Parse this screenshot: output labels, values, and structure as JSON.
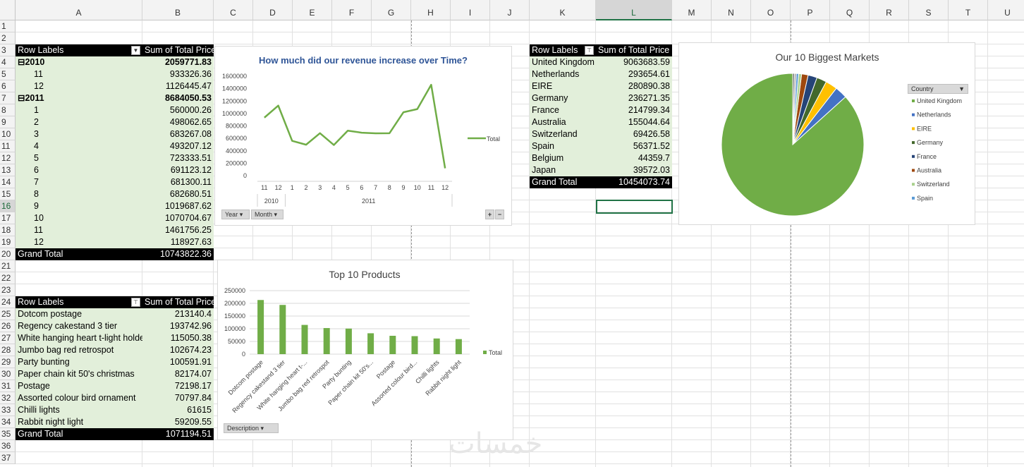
{
  "columns": [
    "A",
    "B",
    "C",
    "D",
    "E",
    "F",
    "G",
    "H",
    "I",
    "J",
    "K",
    "L",
    "M",
    "N",
    "O",
    "P",
    "Q",
    "R",
    "S",
    "T",
    "U"
  ],
  "rows": [
    "1",
    "2",
    "3",
    "4",
    "5",
    "6",
    "7",
    "8",
    "9",
    "10",
    "11",
    "12",
    "13",
    "14",
    "15",
    "16",
    "17",
    "18",
    "19",
    "20",
    "21",
    "22",
    "23",
    "24",
    "25",
    "26",
    "27",
    "28",
    "29",
    "30",
    "31",
    "32",
    "33",
    "34",
    "35",
    "36",
    "37"
  ],
  "pivot_revenue": {
    "header_labels": "Row Labels",
    "header_value": "Sum of Total Price",
    "rows": [
      {
        "label": "⊟2010",
        "value": "2059771.83",
        "bold": true
      },
      {
        "label": "11",
        "value": "933326.36"
      },
      {
        "label": "12",
        "value": "1126445.47"
      },
      {
        "label": "⊟2011",
        "value": "8684050.53",
        "bold": true
      },
      {
        "label": "1",
        "value": "560000.26"
      },
      {
        "label": "2",
        "value": "498062.65"
      },
      {
        "label": "3",
        "value": "683267.08"
      },
      {
        "label": "4",
        "value": "493207.12"
      },
      {
        "label": "5",
        "value": "723333.51"
      },
      {
        "label": "6",
        "value": "691123.12"
      },
      {
        "label": "7",
        "value": "681300.11"
      },
      {
        "label": "8",
        "value": "682680.51"
      },
      {
        "label": "9",
        "value": "1019687.62"
      },
      {
        "label": "10",
        "value": "1070704.67"
      },
      {
        "label": "11",
        "value": "1461756.25"
      },
      {
        "label": "12",
        "value": "118927.63"
      }
    ],
    "total_label": "Grand Total",
    "total_value": "10743822.36"
  },
  "pivot_products": {
    "header_labels": "Row Labels",
    "header_value": "Sum of Total Price",
    "rows": [
      {
        "label": "Dotcom postage",
        "value": "213140.4"
      },
      {
        "label": "Regency cakestand 3 tier",
        "value": "193742.96"
      },
      {
        "label": "White hanging heart t-light holde",
        "value": "115050.38"
      },
      {
        "label": "Jumbo bag red retrospot",
        "value": "102674.23"
      },
      {
        "label": "Party bunting",
        "value": "100591.91"
      },
      {
        "label": "Paper chain kit 50's christmas",
        "value": "82174.07"
      },
      {
        "label": "Postage",
        "value": "72198.17"
      },
      {
        "label": "Assorted colour bird ornament",
        "value": "70797.84"
      },
      {
        "label": "Chilli lights",
        "value": "61615"
      },
      {
        "label": "Rabbit night light",
        "value": "59209.55"
      }
    ],
    "total_label": "Grand Total",
    "total_value": "1071194.51"
  },
  "pivot_markets": {
    "header_labels": "Row Labels",
    "header_value": "Sum of Total Price",
    "rows": [
      {
        "label": "United Kingdom",
        "value": "9063683.59"
      },
      {
        "label": "Netherlands",
        "value": "293654.61"
      },
      {
        "label": "EIRE",
        "value": "280890.38"
      },
      {
        "label": "Germany",
        "value": "236271.35"
      },
      {
        "label": "France",
        "value": "214799.34"
      },
      {
        "label": "Australia",
        "value": "155044.64"
      },
      {
        "label": "Switzerland",
        "value": "69426.58"
      },
      {
        "label": "Spain",
        "value": "56371.52"
      },
      {
        "label": "Belgium",
        "value": "44359.7"
      },
      {
        "label": "Japan",
        "value": "39572.03"
      }
    ],
    "total_label": "Grand Total",
    "total_value": "10454073.74"
  },
  "line_chart": {
    "legend": "Total",
    "buttons": {
      "year": "Year",
      "month": "Month",
      "expand": "+",
      "collapse": "−"
    }
  },
  "bar_chart": {
    "legend": "Total",
    "buttons": {
      "description": "Description"
    }
  },
  "pie_chart": {
    "legend_header": "Country"
  },
  "watermark": "خمسات",
  "chart_data": [
    {
      "type": "line",
      "title": "How much did our revenue increase over Time?",
      "x": [
        "11",
        "12",
        "1",
        "2",
        "3",
        "4",
        "5",
        "6",
        "7",
        "8",
        "9",
        "10",
        "11",
        "12"
      ],
      "groups": [
        {
          "label": "2010",
          "span": 2
        },
        {
          "label": "2011",
          "span": 12
        }
      ],
      "series": [
        {
          "name": "Total",
          "values": [
            933326.36,
            1126445.47,
            560000.26,
            498062.65,
            683267.08,
            493207.12,
            723333.51,
            691123.12,
            681300.11,
            682680.51,
            1019687.62,
            1070704.67,
            1461756.25,
            118927.63
          ]
        }
      ],
      "ylim": [
        0,
        1600000
      ],
      "yticks": [
        "0",
        "200000",
        "400000",
        "600000",
        "800000",
        "1000000",
        "1200000",
        "1400000",
        "1600000"
      ],
      "grid": false,
      "color": "#70ad47",
      "legend_position": "right"
    },
    {
      "type": "bar",
      "title": "Top 10 Products",
      "categories": [
        "Dotcom postage",
        "Regency cakestand 3 tier",
        "White hanging heart t-...",
        "Jumbo bag red retrospot",
        "Party bunting",
        "Paper chain kit 50's...",
        "Postage",
        "Assorted colour bird...",
        "Chilli lights",
        "Rabbit night light"
      ],
      "series": [
        {
          "name": "Total",
          "values": [
            213140.4,
            193742.96,
            115050.38,
            102674.23,
            100591.91,
            82174.07,
            72198.17,
            70797.84,
            61615,
            59209.55
          ]
        }
      ],
      "ylim": [
        0,
        250000
      ],
      "yticks": [
        "0",
        "50000",
        "100000",
        "150000",
        "200000",
        "250000"
      ],
      "grid": true,
      "color": "#70ad47",
      "legend_position": "right"
    },
    {
      "type": "pie",
      "title": "Our 10 Biggest Markets",
      "categories": [
        "United Kingdom",
        "Netherlands",
        "EIRE",
        "Germany",
        "France",
        "Australia",
        "Switzerland",
        "Spain",
        "Belgium",
        "Japan"
      ],
      "values": [
        9063683.59,
        293654.61,
        280890.38,
        236271.35,
        214799.34,
        155044.64,
        69426.58,
        56371.52,
        44359.7,
        39572.03
      ],
      "colors": [
        "#70ad47",
        "#4472c4",
        "#ffc000",
        "#43682b",
        "#264478",
        "#9e480e",
        "#a9d18e",
        "#5b9bd5",
        "#a5a5a5",
        "#636363"
      ],
      "legend_shown": 8,
      "legend_position": "right"
    }
  ]
}
